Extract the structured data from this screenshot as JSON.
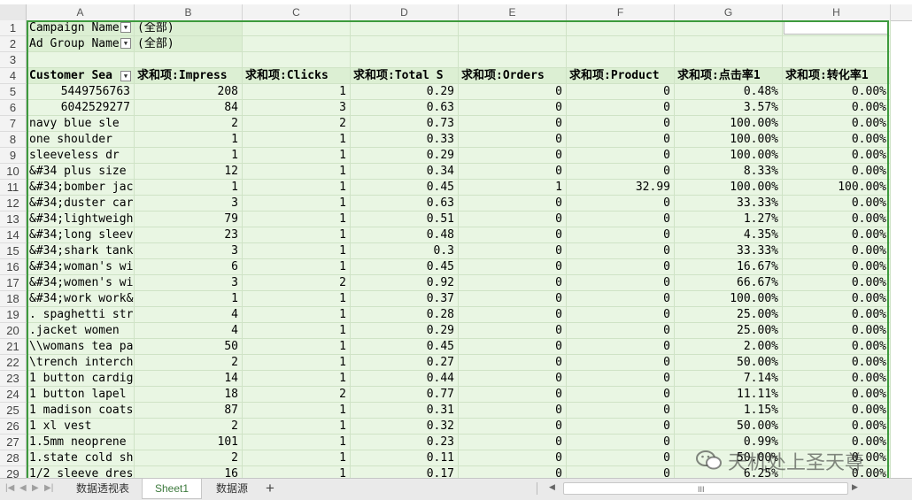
{
  "columns": [
    "A",
    "B",
    "C",
    "D",
    "E",
    "F",
    "G",
    "H"
  ],
  "filters": [
    {
      "row": 1,
      "label": "Campaign Name",
      "value": "(全部)"
    },
    {
      "row": 2,
      "label": "Ad Group Name",
      "value": "(全部)"
    }
  ],
  "headers": [
    "Customer Sea",
    "求和项:Impress",
    "求和项:Clicks",
    "求和项:Total S",
    "求和项:Orders",
    "求和项:Product",
    "求和项:点击率1",
    "求和项:转化率1"
  ],
  "rows": [
    {
      "n": 5,
      "a": "5449756763",
      "b": "208",
      "c": "1",
      "d": "0.29",
      "e": "0",
      "f": "0",
      "g": "0.48%",
      "h": "0.00%"
    },
    {
      "n": 6,
      "a": "6042529277",
      "b": "84",
      "c": "3",
      "d": "0.63",
      "e": "0",
      "f": "0",
      "g": "3.57%",
      "h": "0.00%"
    },
    {
      "n": 7,
      "a": "navy blue sle",
      "b": "2",
      "c": "2",
      "d": "0.73",
      "e": "0",
      "f": "0",
      "g": "100.00%",
      "h": "0.00%"
    },
    {
      "n": 8,
      "a": "one shoulder",
      "b": "1",
      "c": "1",
      "d": "0.33",
      "e": "0",
      "f": "0",
      "g": "100.00%",
      "h": "0.00%"
    },
    {
      "n": 9,
      "a": "sleeveless dr",
      "b": "1",
      "c": "1",
      "d": "0.29",
      "e": "0",
      "f": "0",
      "g": "100.00%",
      "h": "0.00%"
    },
    {
      "n": 10,
      "a": "&#34 plus size",
      "b": "12",
      "c": "1",
      "d": "0.34",
      "e": "0",
      "f": "0",
      "g": "8.33%",
      "h": "0.00%"
    },
    {
      "n": 11,
      "a": "&#34;bomber jac",
      "b": "1",
      "c": "1",
      "d": "0.45",
      "e": "1",
      "f": "32.99",
      "g": "100.00%",
      "h": "100.00%"
    },
    {
      "n": 12,
      "a": "&#34;duster car",
      "b": "3",
      "c": "1",
      "d": "0.63",
      "e": "0",
      "f": "0",
      "g": "33.33%",
      "h": "0.00%"
    },
    {
      "n": 13,
      "a": "&#34;lightweigh",
      "b": "79",
      "c": "1",
      "d": "0.51",
      "e": "0",
      "f": "0",
      "g": "1.27%",
      "h": "0.00%"
    },
    {
      "n": 14,
      "a": "&#34;long sleev",
      "b": "23",
      "c": "1",
      "d": "0.48",
      "e": "0",
      "f": "0",
      "g": "4.35%",
      "h": "0.00%"
    },
    {
      "n": 15,
      "a": "&#34;shark tank",
      "b": "3",
      "c": "1",
      "d": "0.3",
      "e": "0",
      "f": "0",
      "g": "33.33%",
      "h": "0.00%"
    },
    {
      "n": 16,
      "a": "&#34;woman's wi",
      "b": "6",
      "c": "1",
      "d": "0.45",
      "e": "0",
      "f": "0",
      "g": "16.67%",
      "h": "0.00%"
    },
    {
      "n": 17,
      "a": "&#34;women's wi",
      "b": "3",
      "c": "2",
      "d": "0.92",
      "e": "0",
      "f": "0",
      "g": "66.67%",
      "h": "0.00%"
    },
    {
      "n": 18,
      "a": "&#34;work work&",
      "b": "1",
      "c": "1",
      "d": "0.37",
      "e": "0",
      "f": "0",
      "g": "100.00%",
      "h": "0.00%"
    },
    {
      "n": 19,
      "a": ". spaghetti str",
      "b": "4",
      "c": "1",
      "d": "0.28",
      "e": "0",
      "f": "0",
      "g": "25.00%",
      "h": "0.00%"
    },
    {
      "n": 20,
      "a": ".jacket women",
      "b": "4",
      "c": "1",
      "d": "0.29",
      "e": "0",
      "f": "0",
      "g": "25.00%",
      "h": "0.00%"
    },
    {
      "n": 21,
      "a": "\\\\womans tea pa",
      "b": "50",
      "c": "1",
      "d": "0.45",
      "e": "0",
      "f": "0",
      "g": "2.00%",
      "h": "0.00%"
    },
    {
      "n": 22,
      "a": "\\trench interch",
      "b": "2",
      "c": "1",
      "d": "0.27",
      "e": "0",
      "f": "0",
      "g": "50.00%",
      "h": "0.00%"
    },
    {
      "n": 23,
      "a": "1 button cardig",
      "b": "14",
      "c": "1",
      "d": "0.44",
      "e": "0",
      "f": "0",
      "g": "7.14%",
      "h": "0.00%"
    },
    {
      "n": 24,
      "a": "1 button lapel",
      "b": "18",
      "c": "2",
      "d": "0.77",
      "e": "0",
      "f": "0",
      "g": "11.11%",
      "h": "0.00%"
    },
    {
      "n": 25,
      "a": "1 madison coats",
      "b": "87",
      "c": "1",
      "d": "0.31",
      "e": "0",
      "f": "0",
      "g": "1.15%",
      "h": "0.00%"
    },
    {
      "n": 26,
      "a": "1 xl vest",
      "b": "2",
      "c": "1",
      "d": "0.32",
      "e": "0",
      "f": "0",
      "g": "50.00%",
      "h": "0.00%"
    },
    {
      "n": 27,
      "a": "1.5mm neoprene",
      "b": "101",
      "c": "1",
      "d": "0.23",
      "e": "0",
      "f": "0",
      "g": "0.99%",
      "h": "0.00%"
    },
    {
      "n": 28,
      "a": "1.state cold sh",
      "b": "2",
      "c": "1",
      "d": "0.11",
      "e": "0",
      "f": "0",
      "g": "50.00%",
      "h": "0.00%"
    },
    {
      "n": 29,
      "a": "1/2 sleeve dres",
      "b": "16",
      "c": "1",
      "d": "0.17",
      "e": "0",
      "f": "0",
      "g": "6.25%",
      "h": "0.00%"
    }
  ],
  "tabs": [
    {
      "label": "数据透视表",
      "active": false
    },
    {
      "label": "Sheet1",
      "active": true
    },
    {
      "label": "数据源",
      "active": false
    }
  ],
  "add_tab": "+",
  "scroll_thumb": "III",
  "watermark": "天机处上圣天尊",
  "colors": {
    "pivot_bg": "#e9f6e3",
    "header_bg": "#dcefd3",
    "frame": "#3d9a3d",
    "active_tab_text": "#3d7a3d"
  }
}
